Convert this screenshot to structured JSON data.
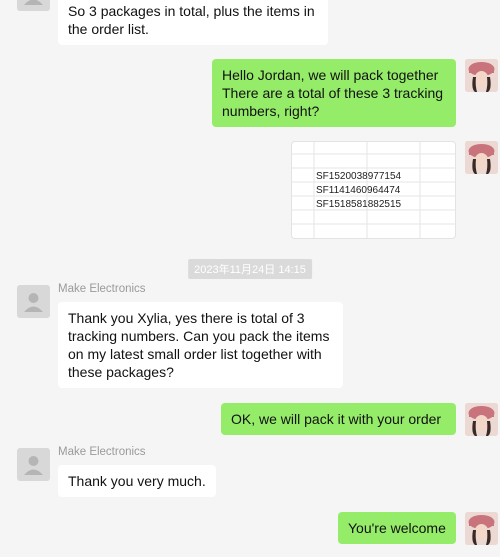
{
  "messages": {
    "m1_text": "So 3 packages in total, plus the items in\nthe order list.",
    "m2_text": "Hello Jordan, we will pack together\nThere are a total of these 3 tracking\nnumbers, right?",
    "m3_tracking": [
      "SF1520038977154",
      "SF1141460964474",
      "SF1518581882515"
    ],
    "timestamp": "2023年11月24日 14:15",
    "m4_sender": "Make Electronics",
    "m4_text": "Thank you Xylia, yes there is total of 3\ntracking numbers. Can you pack the items\non my latest small order list together with\nthese packages?",
    "m5_text": "OK, we will pack it with your order",
    "m6_sender": "Make Electronics",
    "m6_text": "Thank you very much.",
    "m7_text": "You're welcome"
  },
  "colors": {
    "background": "#f5f5f5",
    "incoming_bubble": "#ffffff",
    "outgoing_bubble": "#95ec69",
    "sender_name": "#9a9a9a",
    "timestamp_bg": "#dadada"
  },
  "icons": {
    "incoming_avatar": "person-placeholder-icon",
    "outgoing_avatar": "user-photo-avatar"
  }
}
